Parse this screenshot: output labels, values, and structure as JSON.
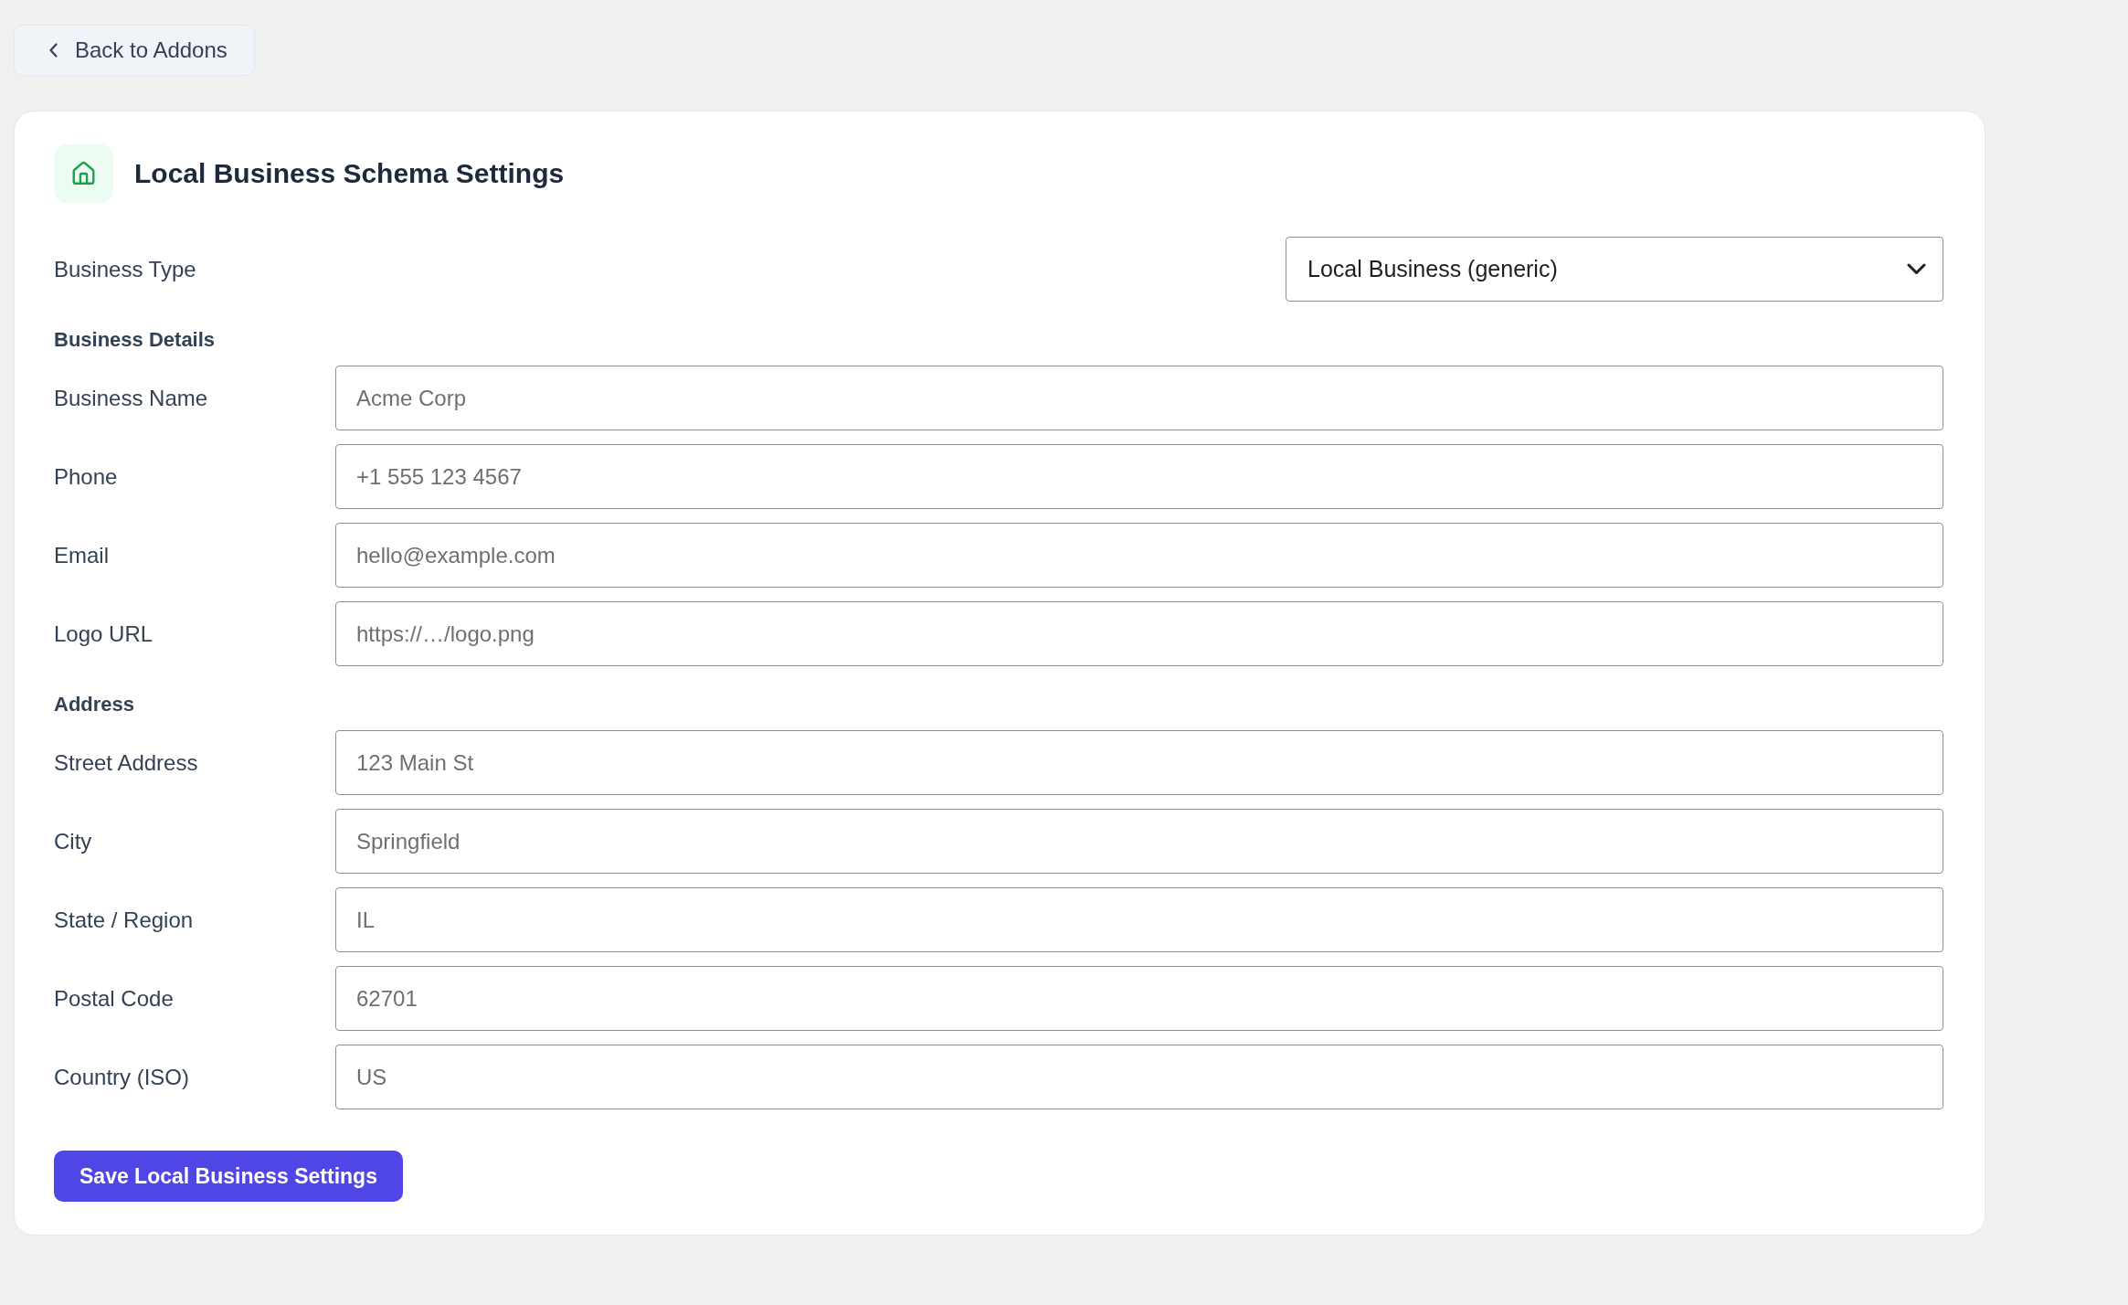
{
  "back_button": {
    "label": "Back to Addons"
  },
  "settings_card": {
    "title": "Local Business Schema Settings",
    "business_type": {
      "label": "Business Type",
      "value": "Local Business (generic)"
    },
    "sections": [
      {
        "heading": "Business Details",
        "fields": [
          {
            "label": "Business Name",
            "placeholder": "Acme Corp"
          },
          {
            "label": "Phone",
            "placeholder": "+1 555 123 4567"
          },
          {
            "label": "Email",
            "placeholder": "hello@example.com"
          },
          {
            "label": "Logo URL",
            "placeholder": "https://…/logo.png"
          }
        ]
      },
      {
        "heading": "Address",
        "fields": [
          {
            "label": "Street Address",
            "placeholder": "123 Main St"
          },
          {
            "label": "City",
            "placeholder": "Springfield"
          },
          {
            "label": "State / Region",
            "placeholder": "IL"
          },
          {
            "label": "Postal Code",
            "placeholder": "62701"
          },
          {
            "label": "Country (ISO)",
            "placeholder": "US"
          }
        ]
      }
    ],
    "save_button": {
      "label": "Save Local Business Settings"
    }
  }
}
